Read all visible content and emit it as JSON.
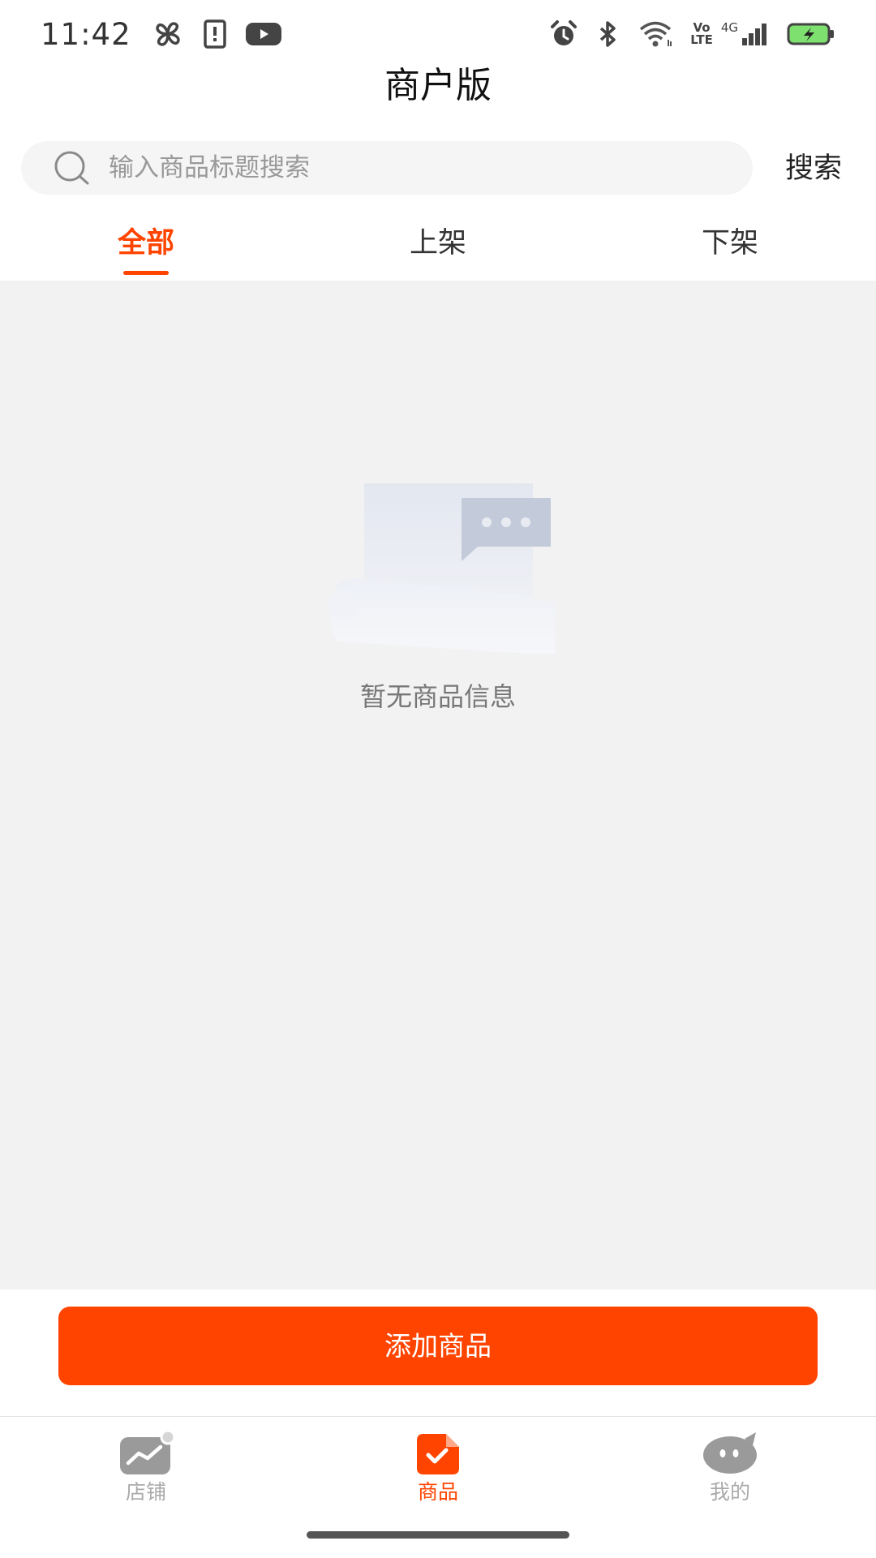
{
  "status_bar": {
    "time": "11:42",
    "network_lte_top": "Vo",
    "network_lte_bottom": "LTE",
    "network_4g": "4G",
    "icons_left": [
      "pinwheel-icon",
      "notification-icon",
      "youtube-icon"
    ],
    "icons_right": [
      "alarm-icon",
      "bluetooth-icon",
      "wifi-icon",
      "signal-icon",
      "battery-charging-icon"
    ]
  },
  "header": {
    "title": "商户版"
  },
  "search": {
    "placeholder": "输入商品标题搜索",
    "value": "",
    "button_label": "搜索"
  },
  "tabs": [
    {
      "label": "全部",
      "active": true
    },
    {
      "label": "上架",
      "active": false
    },
    {
      "label": "下架",
      "active": false
    }
  ],
  "empty_state": {
    "message": "暂无商品信息"
  },
  "actions": {
    "add_product_label": "添加商品"
  },
  "bottom_nav": [
    {
      "label": "店铺",
      "icon": "shop-chart-icon",
      "active": false
    },
    {
      "label": "商品",
      "icon": "product-icon",
      "active": true
    },
    {
      "label": "我的",
      "icon": "profile-icon",
      "active": false
    }
  ],
  "colors": {
    "accent": "#ff4400",
    "background": "#f2f2f2",
    "inactive": "#aaaaaa"
  }
}
